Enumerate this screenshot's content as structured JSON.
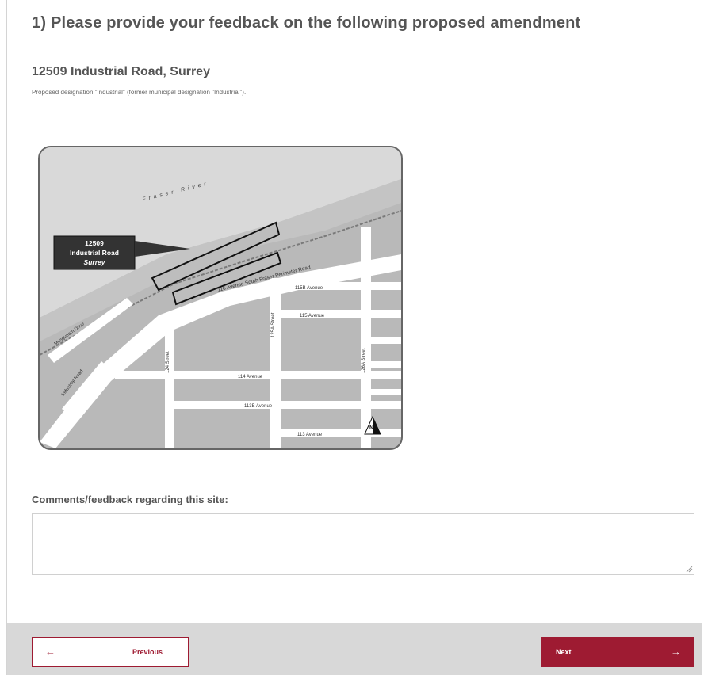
{
  "question": {
    "title": "1) Please provide your feedback on the following proposed amendment"
  },
  "site": {
    "title": "12509 Industrial Road, Surrey",
    "description": "Proposed designation \"Industrial\" (former municipal designation \"Industrial\")."
  },
  "map": {
    "site_label_line1": "12509",
    "site_label_line2": "Industrial Road",
    "site_label_line3": "Surrey",
    "river": "Fraser River",
    "roads": {
      "sfpr": "116 Avenue  South Fraser Perimeter Road",
      "ave_115b": "115B Avenue",
      "ave_115": "115 Avenue",
      "ave_114": "114 Avenue",
      "ave_113b": "113B Avenue",
      "ave_113": "113 Avenue",
      "st_124": "124 Street",
      "st_125a": "125A Street",
      "st_126a": "126A Street",
      "musqueam": "Musqueam Drive",
      "industrial": "Industrial Road"
    },
    "north": "N"
  },
  "comments": {
    "label": "Comments/feedback regarding this site:",
    "value": ""
  },
  "nav": {
    "previous_label": "Previous",
    "next_label": "Next",
    "previous_arrow": "←",
    "next_arrow": "→"
  },
  "colors": {
    "accent": "#9e1b32",
    "text": "#555555",
    "footer_bg": "#d8d8d8"
  }
}
